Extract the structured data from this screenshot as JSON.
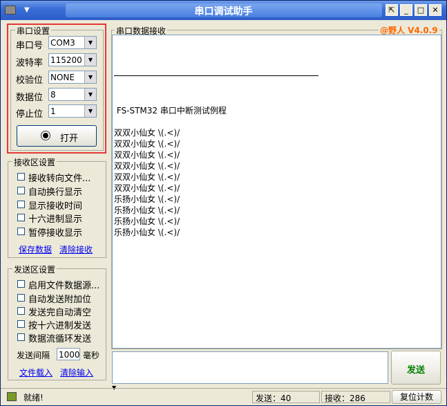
{
  "window": {
    "title": "串口调试助手",
    "version_label": "@野人 V4.0.9",
    "minimize_glyph": "_",
    "maximize_glyph": "□",
    "close_glyph": "✕",
    "restore_glyph": "⇱"
  },
  "serial_settings": {
    "group_title": "串口设置",
    "fields": [
      {
        "label": "串口号",
        "value": "COM3"
      },
      {
        "label": "波特率",
        "value": "115200"
      },
      {
        "label": "校验位",
        "value": "NONE"
      },
      {
        "label": "数据位",
        "value": "8"
      },
      {
        "label": "停止位",
        "value": "1"
      }
    ],
    "open_button_label": "打开"
  },
  "receive_settings": {
    "group_title": "接收区设置",
    "options": [
      "接收转向文件...",
      "自动换行显示",
      "显示接收时间",
      "十六进制显示",
      "暂停接收显示"
    ],
    "save_link": "保存数据",
    "clear_link": "清除接收"
  },
  "send_settings": {
    "group_title": "发送区设置",
    "options": [
      "启用文件数据源...",
      "自动发送附加位",
      "发送完自动清空",
      "按十六进制发送",
      "数据流循环发送"
    ],
    "interval_label": "发送间隔",
    "interval_value": "1000",
    "interval_unit": "毫秒",
    "load_file_link": "文件载入",
    "clear_input_link": "清除输入"
  },
  "receive_area": {
    "group_title": "串口数据接收",
    "lines": [
      " FS-STM32 串口中断测试例程",
      "",
      "双双小仙女 \\(.<)/",
      "双双小仙女 \\(.<)/",
      "双双小仙女 \\(.<)/",
      "双双小仙女 \\(.<)/",
      "双双小仙女 \\(.<)/",
      "双双小仙女 \\(.<)/",
      "乐扬小仙女 \\(.<)/",
      "乐扬小仙女 \\(.<)/",
      "乐扬小仙女 \\(.<)/",
      "乐扬小仙女 \\(.<)/"
    ]
  },
  "send_area": {
    "send_button_label": "发送"
  },
  "status_bar": {
    "status_text": "就绪!",
    "sent_label": "发送：40",
    "received_label": "接收：286",
    "reset_button_label": "复位计数"
  },
  "colors": {
    "title_bar": "#2c5cc8",
    "version_text": "#ff6600",
    "send_button_text": "#008000",
    "highlight_border": "#e53935"
  }
}
